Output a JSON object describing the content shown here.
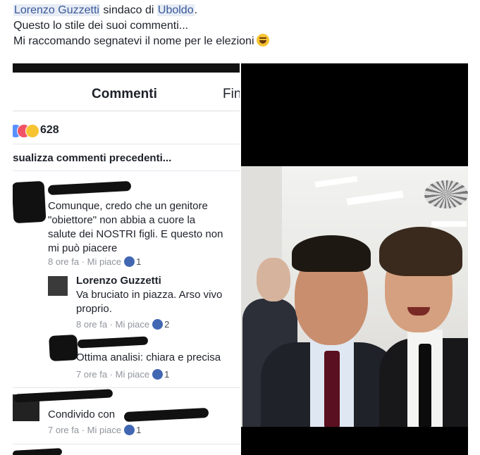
{
  "post": {
    "tag_person": "Lorenzo Guzzetti",
    "text_after_person": " sindaco di ",
    "tag_place": "Uboldo",
    "text_after_place": ".",
    "line2": "Questo lo stile dei suoi commenti...",
    "line3": "Mi raccomando segnatevi il nome per le elezioni",
    "emoji_icon": "laughing-emoji-icon"
  },
  "screenshot": {
    "title": "Commenti",
    "title_right": "Fin",
    "reaction_count": "628",
    "reaction_icons": [
      "like-reaction-icon",
      "love-reaction-icon",
      "haha-reaction-icon"
    ],
    "view_previous": "isualizza commenti precedenti...",
    "comments": [
      {
        "text": "Comunque, credo che un genitore\n\"obiettore\" non abbia a cuore la\nsalute dei NOSTRI figli. E questo non\nmi può piacere",
        "time": "8 ore fa",
        "action": "Mi piace",
        "likes": "1"
      },
      {
        "name": "Lorenzo Guzzetti",
        "text": "Va bruciato in piazza. Arso vivo\nproprio.",
        "time": "8 ore fa",
        "action": "Mi piace",
        "likes": "2"
      },
      {
        "text": "Ottima analisi: chiara e precisa",
        "time": "7 ore fa",
        "action": "Mi piace",
        "likes": "1"
      },
      {
        "text": "Condivido con ",
        "time": "7 ore fa",
        "action": "Mi piace",
        "likes": "1"
      }
    ],
    "separator": " · "
  },
  "colors": {
    "tag_bg": "#e7ecf5",
    "tag_text": "#385898",
    "like_blue": "#4267b2",
    "meta_gray": "#90949c"
  }
}
